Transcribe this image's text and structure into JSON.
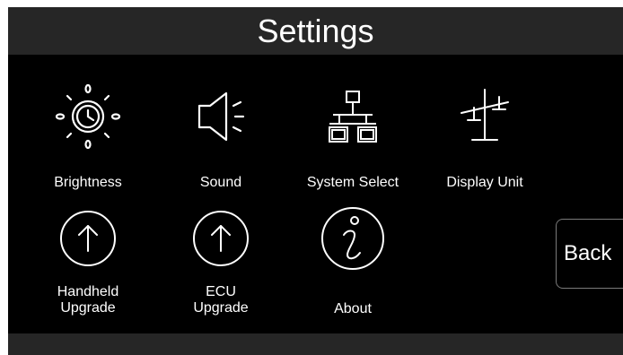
{
  "header": {
    "title": "Settings"
  },
  "menu": {
    "brightness": {
      "label": "Brightness",
      "icon": "sun-icon"
    },
    "sound": {
      "label": "Sound",
      "icon": "speaker-icon"
    },
    "system_select": {
      "label": "System Select",
      "icon": "network-icon"
    },
    "display_unit": {
      "label": "Display Unit",
      "icon": "balance-scale-icon"
    },
    "handheld_upgrade": {
      "label_line1": "Handheld",
      "label_line2": "Upgrade",
      "icon": "upload-arrow-icon"
    },
    "ecu_upgrade": {
      "label_line1": "ECU",
      "label_line2": "Upgrade",
      "icon": "upload-arrow-icon"
    },
    "about": {
      "label": "About",
      "icon": "info-icon"
    }
  },
  "back_button": {
    "label": "Back"
  },
  "colors": {
    "background": "#000000",
    "bar": "#262626",
    "foreground": "#ffffff",
    "button_border": "#7a7a7a"
  }
}
